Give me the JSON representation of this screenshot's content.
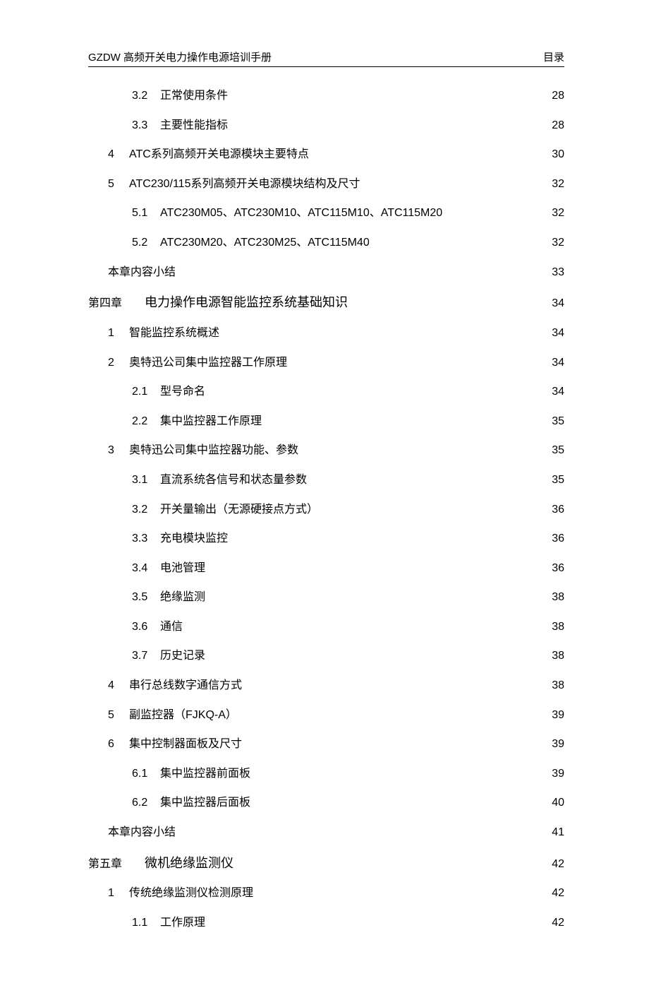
{
  "header": {
    "left": "GZDW 高频开关电力操作电源培训手册",
    "right": "目录"
  },
  "toc": [
    {
      "type": "lvl2",
      "num": "3.2",
      "title": "正常使用条件",
      "page": "28"
    },
    {
      "type": "lvl2",
      "num": "3.3",
      "title": "主要性能指标",
      "page": "28"
    },
    {
      "type": "lvl1",
      "num": "4",
      "title": "ATC系列高频开关电源模块主要特点",
      "page": "30"
    },
    {
      "type": "lvl1",
      "num": "5",
      "title": "ATC230/115系列高频开关电源模块结构及尺寸",
      "page": "32"
    },
    {
      "type": "lvl2",
      "num": "5.1",
      "title": "ATC230M05、ATC230M10、ATC115M10、ATC115M20",
      "page": "32"
    },
    {
      "type": "lvl2",
      "num": "5.2",
      "title": "ATC230M20、ATC230M25、ATC115M40",
      "page": "32"
    },
    {
      "type": "summary",
      "title": "本章内容小结",
      "page": "33"
    },
    {
      "type": "chapter",
      "chapter": "第四章",
      "title": "电力操作电源智能监控系统基础知识",
      "page": "34"
    },
    {
      "type": "lvl1",
      "num": "1",
      "title": "智能监控系统概述",
      "page": "34"
    },
    {
      "type": "lvl1",
      "num": "2",
      "title": "奥特迅公司集中监控器工作原理",
      "page": "34"
    },
    {
      "type": "lvl2",
      "num": "2.1",
      "title": "型号命名",
      "page": "34"
    },
    {
      "type": "lvl2",
      "num": "2.2",
      "title": "集中监控器工作原理",
      "page": "35"
    },
    {
      "type": "lvl1",
      "num": "3",
      "title": "奥特迅公司集中监控器功能、参数",
      "page": "35"
    },
    {
      "type": "lvl2",
      "num": "3.1",
      "title": "直流系统各信号和状态量参数",
      "page": "35"
    },
    {
      "type": "lvl2",
      "num": "3.2",
      "title": "开关量输出（无源硬接点方式）",
      "page": "36"
    },
    {
      "type": "lvl2",
      "num": "3.3",
      "title": "充电模块监控",
      "page": "36"
    },
    {
      "type": "lvl2",
      "num": "3.4",
      "title": "电池管理",
      "page": "36"
    },
    {
      "type": "lvl2",
      "num": "3.5",
      "title": "绝缘监测",
      "page": "38"
    },
    {
      "type": "lvl2",
      "num": "3.6",
      "title": "通信",
      "page": "38"
    },
    {
      "type": "lvl2",
      "num": "3.7",
      "title": "历史记录",
      "page": "38"
    },
    {
      "type": "lvl1",
      "num": "4",
      "title": "串行总线数字通信方式",
      "page": "38"
    },
    {
      "type": "lvl1",
      "num": "5",
      "title": "副监控器（FJKQ-A）",
      "page": "39"
    },
    {
      "type": "lvl1",
      "num": "6",
      "title": "集中控制器面板及尺寸",
      "page": "39"
    },
    {
      "type": "lvl2",
      "num": "6.1",
      "title": "集中监控器前面板",
      "page": "39"
    },
    {
      "type": "lvl2",
      "num": "6.2",
      "title": "集中监控器后面板",
      "page": "40"
    },
    {
      "type": "summary",
      "title": "本章内容小结",
      "page": "41"
    },
    {
      "type": "chapter",
      "chapter": "第五章",
      "title": "微机绝缘监测仪",
      "page": "42"
    },
    {
      "type": "lvl1",
      "num": "1",
      "title": "传统绝缘监测仪检测原理",
      "page": "42"
    },
    {
      "type": "lvl2",
      "num": "1.1",
      "title": "工作原理",
      "page": "42"
    }
  ]
}
